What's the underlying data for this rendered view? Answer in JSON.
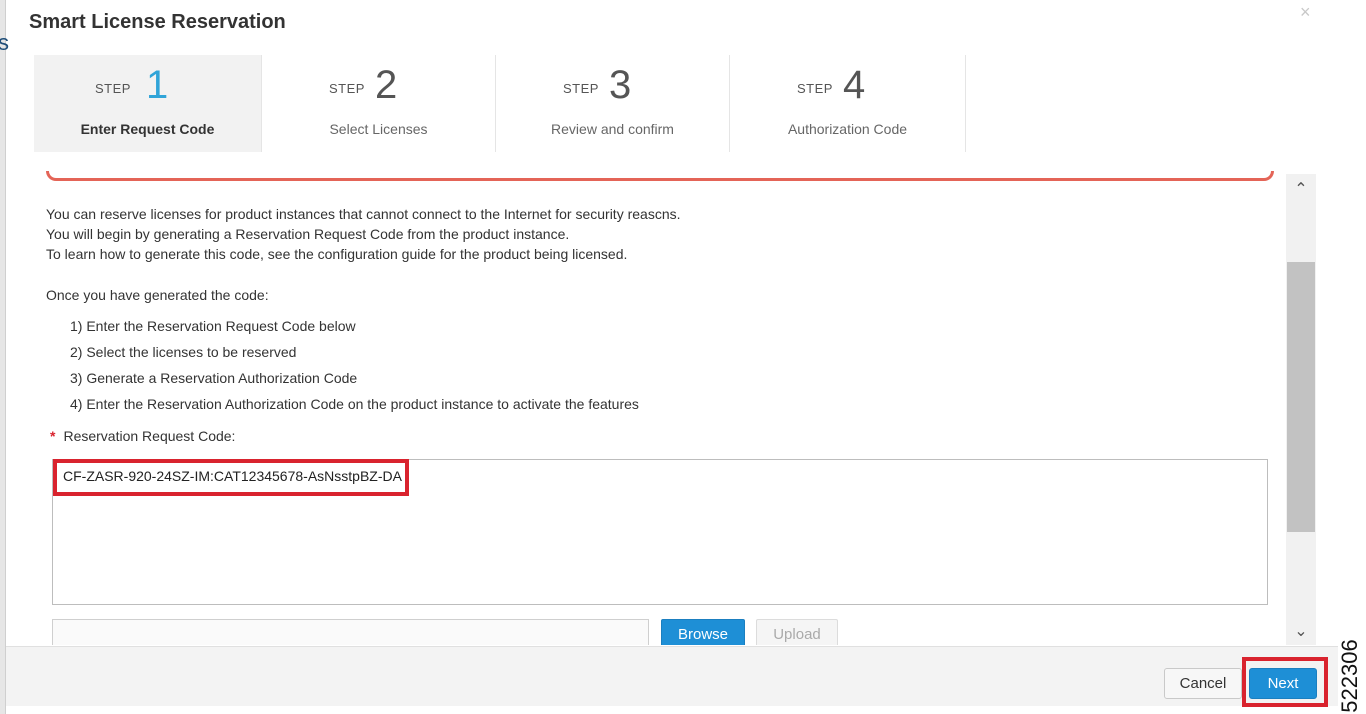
{
  "dialog": {
    "title": "Smart License Reservation",
    "close_glyph": "×",
    "side_peek": "s"
  },
  "steps": [
    {
      "word": "STEP",
      "number": "1",
      "label": "Enter Request Code",
      "active": true
    },
    {
      "word": "STEP",
      "number": "2",
      "label": "Select Licenses",
      "active": false
    },
    {
      "word": "STEP",
      "number": "3",
      "label": "Review and confirm",
      "active": false
    },
    {
      "word": "STEP",
      "number": "4",
      "label": "Authorization Code",
      "active": false
    }
  ],
  "intro": [
    "You can reserve licenses for product instances that cannot connect to the Internet for security reascns.",
    "You will begin by generating a Reservation Request Code from the product instance.",
    "To learn how to generate this code, see the configuration guide for the product being licensed."
  ],
  "once_text": "Once you have generated the code:",
  "instructions": [
    "1) Enter the Reservation Request Code below",
    "2) Select the licenses to be reserved",
    "3) Generate a Reservation Authorization Code",
    "4) Enter the Reservation Authorization Code on the product instance to activate the features"
  ],
  "request_code": {
    "required_mark": "*",
    "label": "Reservation Request Code:",
    "value": "CF-ZASR-920-24SZ-IM:CAT12345678-AsNsstpBZ-DA"
  },
  "upload": {
    "browse_label": "Browse",
    "upload_label": "Upload"
  },
  "footer": {
    "cancel_label": "Cancel",
    "next_label": "Next"
  },
  "scroll": {
    "up_glyph": "⌃",
    "down_glyph": "⌄"
  },
  "figure_number": "522306",
  "colors": {
    "accent": "#1e8fd6",
    "active_step_number": "#30a4d8",
    "highlight": "#d9232e"
  }
}
